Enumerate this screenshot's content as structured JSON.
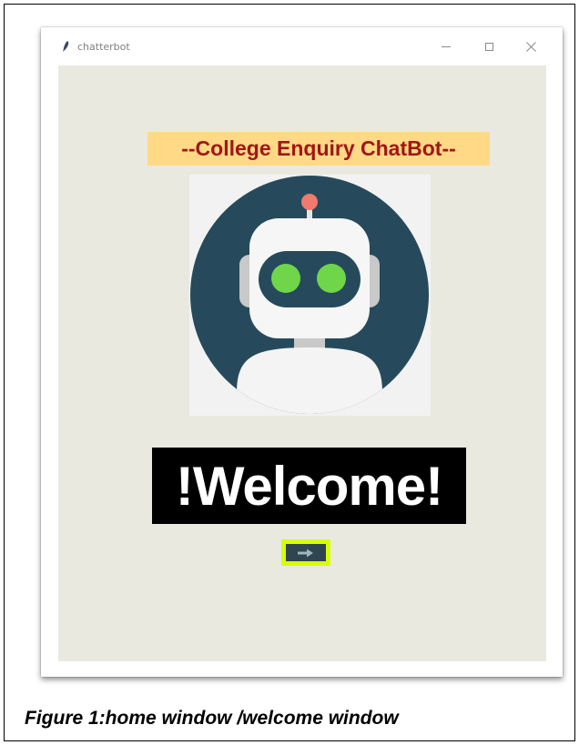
{
  "window": {
    "title": "chatterbot",
    "controls": [
      "minimize",
      "maximize",
      "close"
    ]
  },
  "app": {
    "heading": "--College Enquiry ChatBot--",
    "image": "robot-avatar",
    "welcome_text": "!Welcome!",
    "next_button_icon": "right-arrow-icon"
  },
  "caption": "Figure 1:home window /welcome window",
  "colors": {
    "heading_bg": "#ffd985",
    "heading_text": "#a11616",
    "client_bg": "#e9e9e0",
    "welcome_bg": "#000000",
    "welcome_text": "#ffffff",
    "button_border": "#d9ff00",
    "button_fill": "#2f4550",
    "robot_circle": "#264a5c",
    "robot_eyes": "#6fd64a",
    "robot_antenna": "#ef7a6d"
  }
}
